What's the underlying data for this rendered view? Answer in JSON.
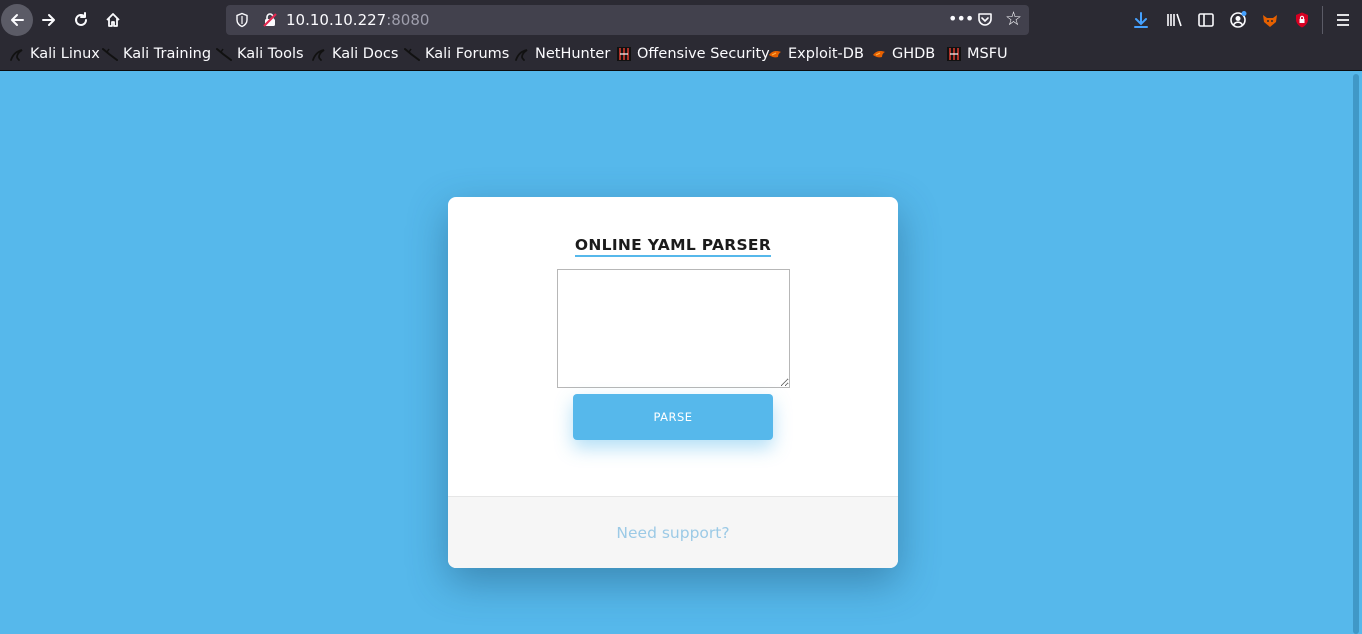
{
  "browser": {
    "url_host": "10.10.10.227",
    "url_port": ":8080",
    "bookmarks": [
      {
        "label": "Kali Linux",
        "icon": "kali-dragon-icon"
      },
      {
        "label": "Kali Training",
        "icon": "kali-dragon-icon"
      },
      {
        "label": "Kali Tools",
        "icon": "kali-dragon-icon"
      },
      {
        "label": "Kali Docs",
        "icon": "kali-dragon-icon"
      },
      {
        "label": "Kali Forums",
        "icon": "kali-dragon-icon"
      },
      {
        "label": "NetHunter",
        "icon": "kali-dragon-icon"
      },
      {
        "label": "Offensive Security",
        "icon": "offsec-icon"
      },
      {
        "label": "Exploit-DB",
        "icon": "exploit-db-icon"
      },
      {
        "label": "GHDB",
        "icon": "exploit-db-icon"
      },
      {
        "label": "MSFU",
        "icon": "offsec-icon"
      }
    ]
  },
  "page": {
    "title": "ONLINE YAML PARSER",
    "input_value": "",
    "parse_label": "PARSE",
    "support_label": "Need support?"
  },
  "colors": {
    "background": "#56b8eb",
    "accent": "#56b8eb",
    "link": "#9ccae6"
  }
}
